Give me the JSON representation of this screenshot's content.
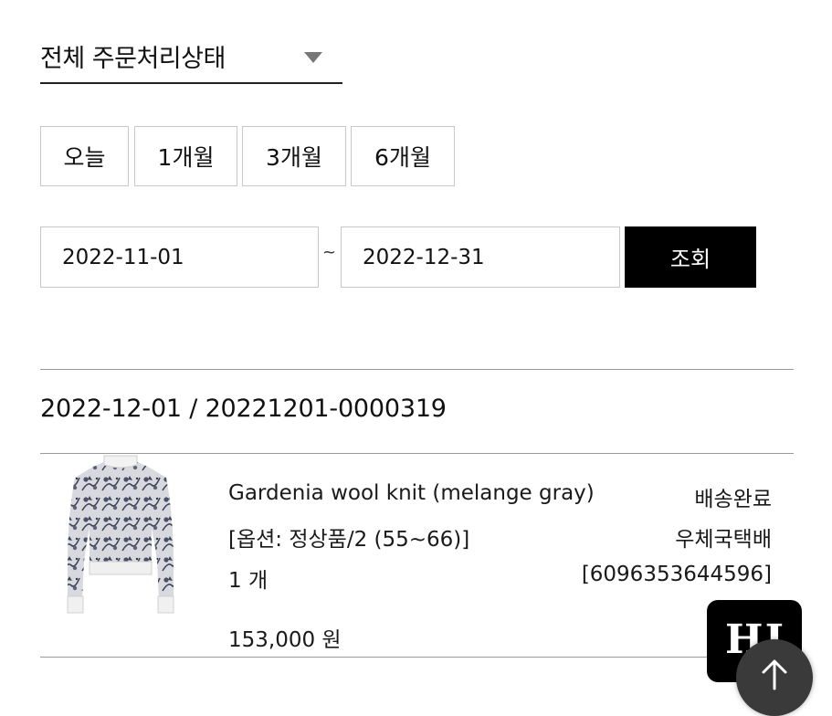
{
  "filter": {
    "status_label": "전체 주문처리상태",
    "periods": [
      "오늘",
      "1개월",
      "3개월",
      "6개월"
    ],
    "date_from": "2022-11-01",
    "date_separator": "~",
    "date_to": "2022-12-31",
    "search_label": "조회"
  },
  "order": {
    "header": "2022-12-01 / 20221201-0000319",
    "item": {
      "name": "Gardenia wool knit (melange gray)",
      "option": "[옵션: 정상품/2 (55~66)]",
      "quantity": "1 개",
      "price": "153,000 원",
      "status": "배송완료",
      "carrier": "우체국택배",
      "tracking": "[6096353644596]"
    }
  },
  "floating": {
    "brand_monogram": "HI",
    "top_icon": "arrow-up-icon"
  },
  "colors": {
    "primary_button": "#000000",
    "border": "#c8c8c8",
    "divider": "#9a9a9a"
  }
}
